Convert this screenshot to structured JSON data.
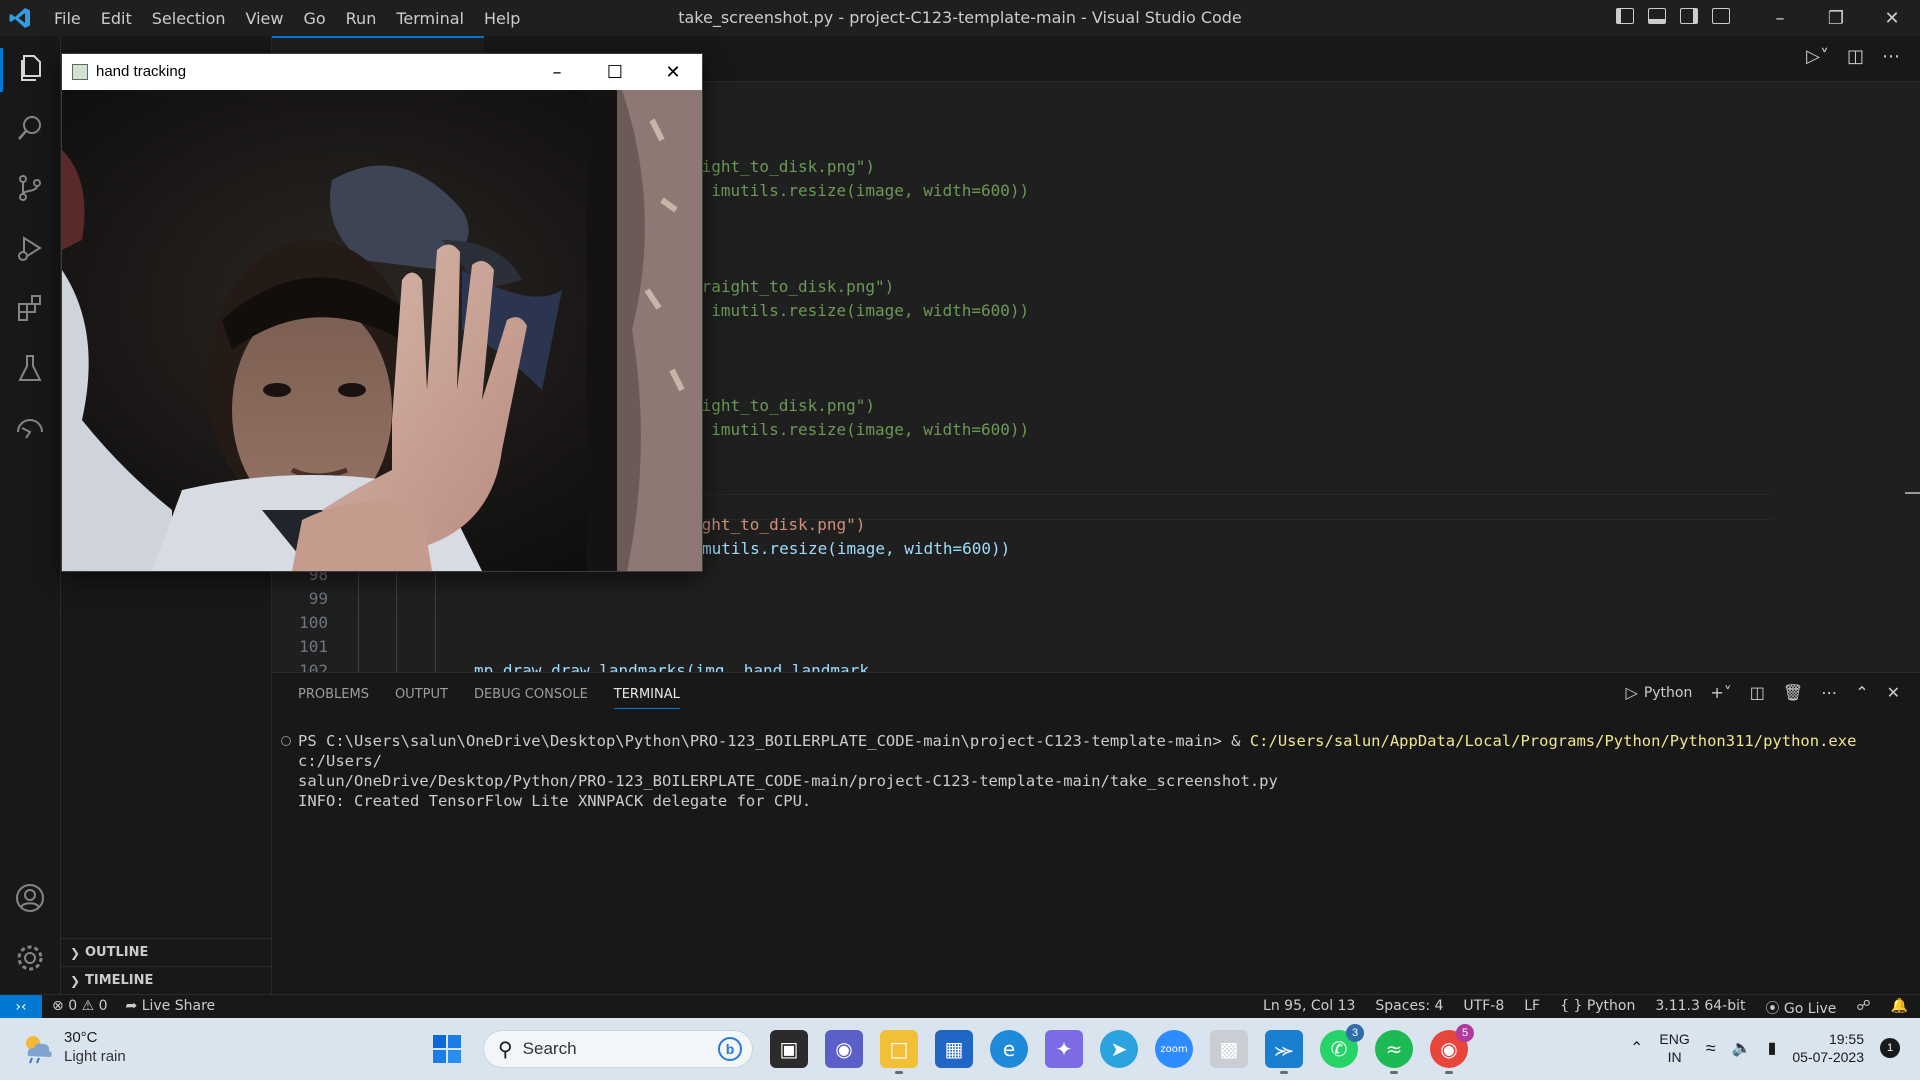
{
  "window": {
    "title": "take_screenshot.py - project-C123-template-main - Visual Studio Code",
    "menu": [
      "File",
      "Edit",
      "Selection",
      "View",
      "Go",
      "Run",
      "Terminal",
      "Help"
    ]
  },
  "sidebar": {
    "outline": "OUTLINE",
    "timeline": "TIMELINE"
  },
  "editor": {
    "visible_code": [
      {
        "text": "aight_to_disk.png\")"
      },
      {
        "text": ", imutils.resize(image, width=600))"
      },
      {
        "text": "traight_to_disk.png\")"
      },
      {
        "text": ", imutils.resize(image, width=600))"
      },
      {
        "text": "aight_to_disk.png\")"
      },
      {
        "text": ", imutils.resize(image, width=600))"
      },
      {
        "text": "ight_to_disk.png\")"
      },
      {
        "text": "mutils.resize(image, width=600))"
      }
    ],
    "line_numbers": [
      "98",
      "99",
      "100",
      "101",
      "102"
    ],
    "last_line": "mp_draw.draw_landmarks(img, hand_landmark,"
  },
  "panel": {
    "tabs": [
      "PROBLEMS",
      "OUTPUT",
      "DEBUG CONSOLE",
      "TERMINAL"
    ],
    "active_tab": "TERMINAL",
    "shell": "Python",
    "terminal_prompt": "PS C:\\Users\\salun\\OneDrive\\Desktop\\Python\\PRO-123_BOILERPLATE_CODE-main\\project-C123-template-main> & ",
    "terminal_cmd": "C:/Users/salun/AppData/Local/Programs/Python/Python311/python.exe",
    "terminal_arg1": " c:/Users/",
    "terminal_arg2": "salun/OneDrive/Desktop/Python/PRO-123_BOILERPLATE_CODE-main/project-C123-template-main/take_screenshot.py",
    "terminal_info": "INFO: Created TensorFlow Lite XNNPACK delegate for CPU."
  },
  "statusbar": {
    "errors": "0",
    "warnings": "0",
    "live_share": "Live Share",
    "position": "Ln 95, Col 13",
    "spaces": "Spaces: 4",
    "encoding": "UTF-8",
    "eol": "LF",
    "language": "Python",
    "interpreter": "3.11.3 64-bit",
    "go_live": "Go Live"
  },
  "float_window": {
    "title": "hand tracking"
  },
  "taskbar": {
    "temp": "30°C",
    "weather": "Light rain",
    "search_placeholder": "Search",
    "whatsapp_badge": "3",
    "chrome_badge": "5",
    "lang": "ENG",
    "region": "IN",
    "time": "19:55",
    "date": "05-07-2023",
    "notifications": "1"
  },
  "colors": {
    "accent": "#0078d4",
    "editor_bg": "#1f1f1f",
    "taskbar_bg": "#d9e4ee"
  }
}
